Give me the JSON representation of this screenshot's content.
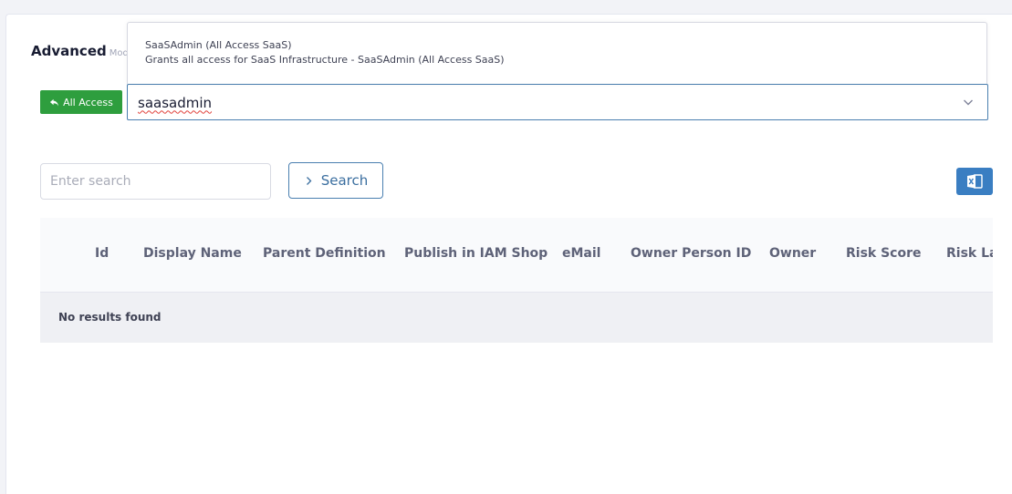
{
  "header": {
    "title": "Advanced",
    "subtitle": "Modi"
  },
  "back_button": {
    "label": "All Access",
    "icon": "reply-arrow-icon"
  },
  "combobox": {
    "value": "saasadmin",
    "icon": "chevron-down-icon"
  },
  "dropdown": {
    "options": [
      {
        "title": "SaaSAdmin (All Access SaaS)",
        "description": "Grants all access for SaaS Infrastructure - SaaSAdmin (All Access SaaS)"
      }
    ]
  },
  "search": {
    "placeholder": "Enter search",
    "button_label": "Search",
    "button_icon": "chevron-right-icon"
  },
  "export": {
    "icon": "excel-icon"
  },
  "table": {
    "columns": [
      "Id",
      "Display Name",
      "Parent Definition",
      "Publish in IAM Shop",
      "eMail",
      "Owner Person ID",
      "Owner",
      "Risk Score",
      "Risk Last"
    ],
    "empty_message": "No results found"
  }
}
